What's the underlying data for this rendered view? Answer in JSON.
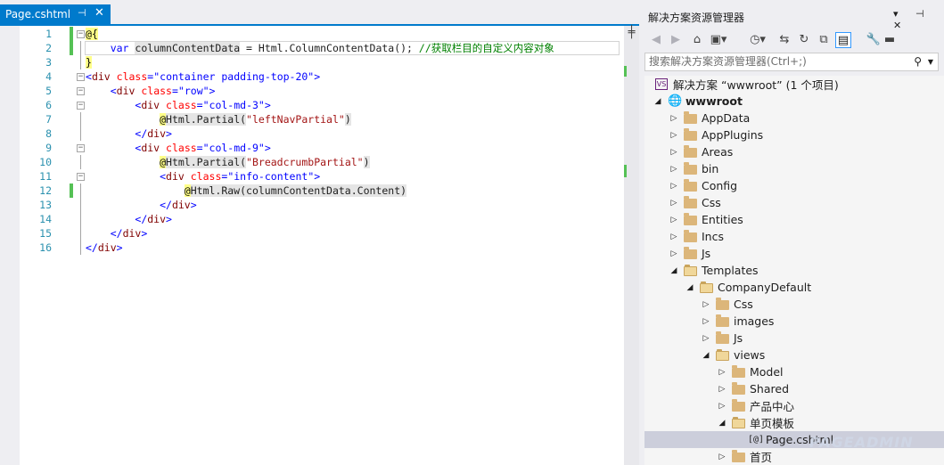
{
  "editor": {
    "tab": {
      "title": "Page.cshtml",
      "pin_glyph": "⊣",
      "close_glyph": "✕"
    },
    "split_glyph": "╪",
    "lines": [
      {
        "n": "1",
        "segs": [
          {
            "t": "@{",
            "c": "razor"
          }
        ],
        "indent": 0,
        "change": true
      },
      {
        "n": "2",
        "segs": [
          {
            "t": "    "
          },
          {
            "t": "var",
            "c": "kw"
          },
          {
            "t": " "
          },
          {
            "t": "columnContentData",
            "c": "hl"
          },
          {
            "t": " = Html.ColumnContentData(); "
          },
          {
            "t": "//获取栏目的自定义内容对象",
            "c": "cmt"
          }
        ],
        "indent": 0,
        "change": true
      },
      {
        "n": "3",
        "segs": [
          {
            "t": "}",
            "c": "razor"
          }
        ],
        "indent": 0,
        "change": false
      },
      {
        "n": "4",
        "segs": [
          {
            "t": "<",
            "c": "kw"
          },
          {
            "t": "div",
            "c": "tag"
          },
          {
            "t": " "
          },
          {
            "t": "class",
            "c": "at"
          },
          {
            "t": "=",
            "c": "kw"
          },
          {
            "t": "\"container padding-top-20\"",
            "c": "kw"
          },
          {
            "t": ">",
            "c": "kw"
          }
        ],
        "indent": 0,
        "change": false
      },
      {
        "n": "5",
        "segs": [
          {
            "t": "    "
          },
          {
            "t": "<",
            "c": "kw"
          },
          {
            "t": "div",
            "c": "tag"
          },
          {
            "t": " "
          },
          {
            "t": "class",
            "c": "at"
          },
          {
            "t": "=",
            "c": "kw"
          },
          {
            "t": "\"row\"",
            "c": "kw"
          },
          {
            "t": ">",
            "c": "kw"
          }
        ],
        "indent": 0,
        "change": false
      },
      {
        "n": "6",
        "segs": [
          {
            "t": "        "
          },
          {
            "t": "<",
            "c": "kw"
          },
          {
            "t": "div",
            "c": "tag"
          },
          {
            "t": " "
          },
          {
            "t": "class",
            "c": "at"
          },
          {
            "t": "=",
            "c": "kw"
          },
          {
            "t": "\"col-md-3\"",
            "c": "kw"
          },
          {
            "t": ">",
            "c": "kw"
          }
        ],
        "indent": 0,
        "change": false
      },
      {
        "n": "7",
        "segs": [
          {
            "t": "            "
          },
          {
            "t": "@",
            "c": "razor"
          },
          {
            "t": "Html.Partial(",
            "c": "hl"
          },
          {
            "t": "\"leftNavPartial\"",
            "c": "str"
          },
          {
            "t": ")",
            "c": "hl"
          }
        ],
        "indent": 0,
        "change": false
      },
      {
        "n": "8",
        "segs": [
          {
            "t": "        "
          },
          {
            "t": "</",
            "c": "kw"
          },
          {
            "t": "div",
            "c": "tag"
          },
          {
            "t": ">",
            "c": "kw"
          }
        ],
        "indent": 0,
        "change": false
      },
      {
        "n": "9",
        "segs": [
          {
            "t": "        "
          },
          {
            "t": "<",
            "c": "kw"
          },
          {
            "t": "div",
            "c": "tag"
          },
          {
            "t": " "
          },
          {
            "t": "class",
            "c": "at"
          },
          {
            "t": "=",
            "c": "kw"
          },
          {
            "t": "\"col-md-9\"",
            "c": "kw"
          },
          {
            "t": ">",
            "c": "kw"
          }
        ],
        "indent": 0,
        "change": false
      },
      {
        "n": "10",
        "segs": [
          {
            "t": "            "
          },
          {
            "t": "@",
            "c": "razor"
          },
          {
            "t": "Html.Partial(",
            "c": "hl"
          },
          {
            "t": "\"BreadcrumbPartial\"",
            "c": "str"
          },
          {
            "t": ")",
            "c": "hl"
          }
        ],
        "indent": 0,
        "change": false
      },
      {
        "n": "11",
        "segs": [
          {
            "t": "            "
          },
          {
            "t": "<",
            "c": "kw"
          },
          {
            "t": "div",
            "c": "tag"
          },
          {
            "t": " "
          },
          {
            "t": "class",
            "c": "at"
          },
          {
            "t": "=",
            "c": "kw"
          },
          {
            "t": "\"info-content\"",
            "c": "kw"
          },
          {
            "t": ">",
            "c": "kw"
          }
        ],
        "indent": 0,
        "change": false
      },
      {
        "n": "12",
        "segs": [
          {
            "t": "                "
          },
          {
            "t": "@",
            "c": "razor"
          },
          {
            "t": "Html.Raw(columnContentData.Content)",
            "c": "hl"
          }
        ],
        "indent": 0,
        "change": true
      },
      {
        "n": "13",
        "segs": [
          {
            "t": "            "
          },
          {
            "t": "</",
            "c": "kw"
          },
          {
            "t": "div",
            "c": "tag"
          },
          {
            "t": ">",
            "c": "kw"
          }
        ],
        "indent": 0,
        "change": false
      },
      {
        "n": "14",
        "segs": [
          {
            "t": "        "
          },
          {
            "t": "</",
            "c": "kw"
          },
          {
            "t": "div",
            "c": "tag"
          },
          {
            "t": ">",
            "c": "kw"
          }
        ],
        "indent": 0,
        "change": false
      },
      {
        "n": "15",
        "segs": [
          {
            "t": "    "
          },
          {
            "t": "</",
            "c": "kw"
          },
          {
            "t": "div",
            "c": "tag"
          },
          {
            "t": ">",
            "c": "kw"
          }
        ],
        "indent": 0,
        "change": false
      },
      {
        "n": "16",
        "segs": [
          {
            "t": "</",
            "c": "kw"
          },
          {
            "t": "div",
            "c": "tag"
          },
          {
            "t": ">",
            "c": "kw"
          }
        ],
        "indent": 0,
        "change": false
      }
    ]
  },
  "solution_explorer": {
    "title": "解决方案资源管理器",
    "title_buttons": "▾ ⊣ ✕",
    "search_placeholder": "搜索解决方案资源管理器(Ctrl+;)",
    "search_icon": "⚲",
    "search_drop": "▼",
    "toolbar": [
      {
        "name": "back-icon",
        "g": "◀",
        "dis": true
      },
      {
        "name": "forward-icon",
        "g": "▶",
        "dis": true
      },
      {
        "name": "home-icon",
        "g": "⌂",
        "dis": false
      },
      {
        "name": "solution-switch-icon",
        "g": "▣▾",
        "dis": false
      },
      {
        "name": "pending-changes-icon",
        "g": "◷▾",
        "dis": false
      },
      {
        "name": "sync-icon",
        "g": "⇆",
        "dis": false
      },
      {
        "name": "refresh-icon",
        "g": "↻",
        "dis": false
      },
      {
        "name": "collapse-all-icon",
        "g": "⧉",
        "dis": false
      },
      {
        "name": "show-all-files-icon",
        "g": "▤",
        "dis": false,
        "act": true
      },
      {
        "name": "properties-icon",
        "g": "🔧",
        "dis": false
      },
      {
        "name": "preview-icon",
        "g": "▬",
        "dis": false
      }
    ],
    "tree": [
      {
        "label": "解决方案 “wwwroot” (1 个项目)",
        "depth": 0,
        "kind": "solution",
        "arrow": ""
      },
      {
        "label": "wwwroot",
        "depth": 0,
        "kind": "web",
        "arrow": "◢",
        "bold": true
      },
      {
        "label": "AppData",
        "depth": 1,
        "kind": "folder",
        "arrow": "▷"
      },
      {
        "label": "AppPlugins",
        "depth": 1,
        "kind": "folder",
        "arrow": "▷"
      },
      {
        "label": "Areas",
        "depth": 1,
        "kind": "folder",
        "arrow": "▷"
      },
      {
        "label": "bin",
        "depth": 1,
        "kind": "folder",
        "arrow": "▷"
      },
      {
        "label": "Config",
        "depth": 1,
        "kind": "folder",
        "arrow": "▷"
      },
      {
        "label": "Css",
        "depth": 1,
        "kind": "folder",
        "arrow": "▷"
      },
      {
        "label": "Entities",
        "depth": 1,
        "kind": "folder",
        "arrow": "▷"
      },
      {
        "label": "Incs",
        "depth": 1,
        "kind": "folder",
        "arrow": "▷"
      },
      {
        "label": "Js",
        "depth": 1,
        "kind": "folder",
        "arrow": "▷"
      },
      {
        "label": "Templates",
        "depth": 1,
        "kind": "folder-open",
        "arrow": "◢"
      },
      {
        "label": "CompanyDefault",
        "depth": 2,
        "kind": "folder-open",
        "arrow": "◢"
      },
      {
        "label": "Css",
        "depth": 3,
        "kind": "folder",
        "arrow": "▷"
      },
      {
        "label": "images",
        "depth": 3,
        "kind": "folder",
        "arrow": "▷"
      },
      {
        "label": "Js",
        "depth": 3,
        "kind": "folder",
        "arrow": "▷"
      },
      {
        "label": "views",
        "depth": 3,
        "kind": "folder-open",
        "arrow": "◢"
      },
      {
        "label": "Model",
        "depth": 4,
        "kind": "folder",
        "arrow": "▷"
      },
      {
        "label": "Shared",
        "depth": 4,
        "kind": "folder",
        "arrow": "▷"
      },
      {
        "label": "产品中心",
        "depth": 4,
        "kind": "folder",
        "arrow": "▷"
      },
      {
        "label": "单页模板",
        "depth": 4,
        "kind": "folder-open",
        "arrow": "◢"
      },
      {
        "label": "Page.cshtml",
        "depth": 5,
        "kind": "file",
        "arrow": "",
        "selected": true
      },
      {
        "label": "首页",
        "depth": 4,
        "kind": "folder",
        "arrow": "▷"
      }
    ]
  },
  "watermark": "PAGEADMIN",
  "colors": {
    "accent": "#007acc",
    "selection": "#cccedb",
    "folder": "#dcb67a",
    "change": "#55c155"
  }
}
